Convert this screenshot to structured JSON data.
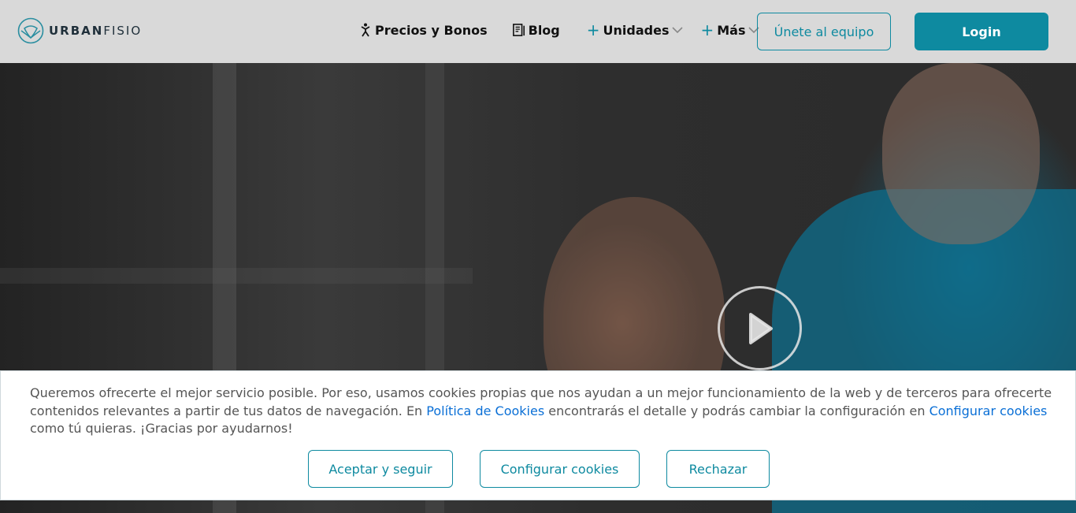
{
  "brand": {
    "name_bold": "URBAN",
    "name_light": "FISIO",
    "logo_icon": "urbanfisio-logo-icon"
  },
  "nav": {
    "precios": {
      "label": "Precios y Bonos",
      "icon": "person-icon"
    },
    "blog": {
      "label": "Blog",
      "icon": "blog-icon"
    },
    "unidades": {
      "label": "Unidades",
      "prefix_icon": "plus-icon",
      "suffix_icon": "chevron-down-icon"
    },
    "mas": {
      "label": "Más",
      "prefix_icon": "plus-icon",
      "suffix_icon": "chevron-down-icon"
    }
  },
  "header": {
    "join_label": "Únete al equipo",
    "login_label": "Login"
  },
  "colors": {
    "accent": "#0e8aa0",
    "link": "#0a6fd6"
  },
  "cookie": {
    "text_1": "Queremos ofrecerte el mejor servicio posible. Por eso, usamos cookies propias que nos ayudan a un mejor funcionamiento de la web y de terceros para ofrecerte contenidos relevantes a partir de tus datos de navegación. En ",
    "link_policy": "Política de Cookies",
    "text_2": " encontrarás el detalle y podrás cambiar la configuración en ",
    "link_config": "Configurar cookies",
    "text_3": " como tú quieras. ¡Gracias por ayudarnos!",
    "accept_label": "Aceptar y seguir",
    "config_label": "Configurar cookies",
    "reject_label": "Rechazar"
  }
}
